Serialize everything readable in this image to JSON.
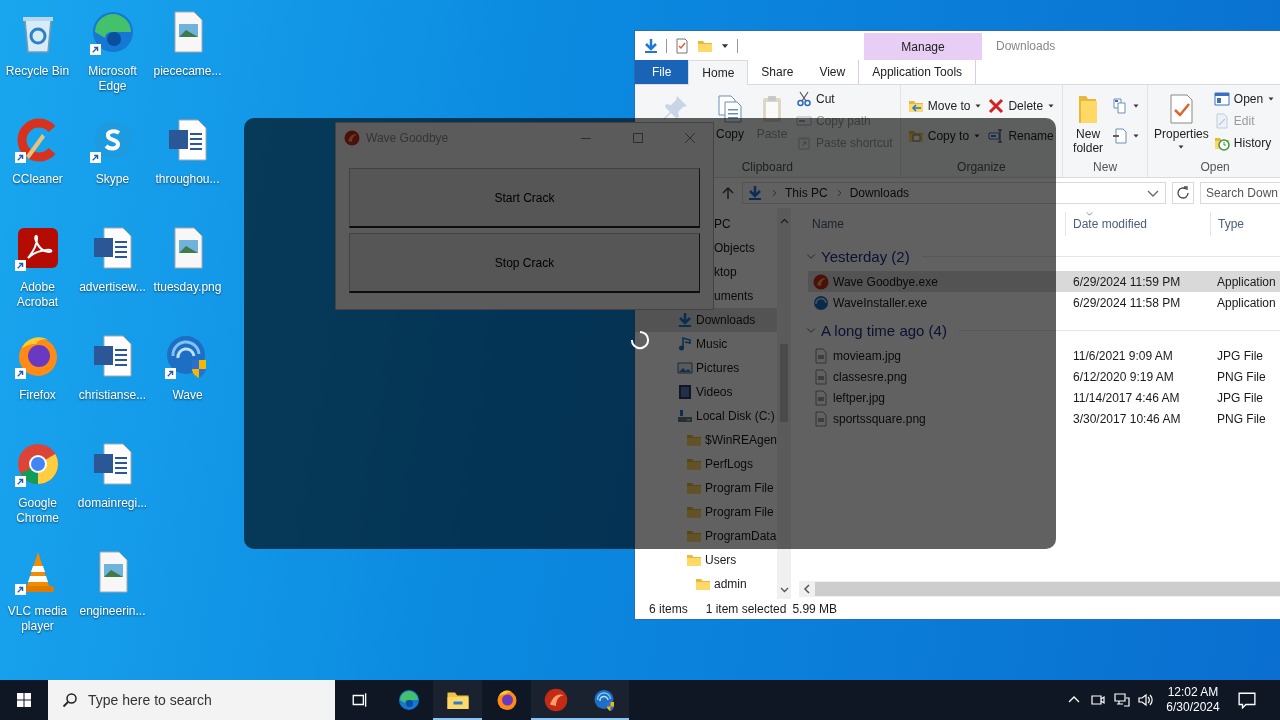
{
  "desktop_icons": [
    {
      "label": "Recycle Bin",
      "kind": "recycle",
      "shortcut": false
    },
    {
      "label": "CCleaner",
      "kind": "ccleaner",
      "shortcut": true
    },
    {
      "label": "Adobe Acrobat",
      "kind": "acrobat",
      "shortcut": true
    },
    {
      "label": "Firefox",
      "kind": "firefox",
      "shortcut": true
    },
    {
      "label": "Google Chrome",
      "kind": "chrome",
      "shortcut": true
    },
    {
      "label": "VLC media player",
      "kind": "vlc",
      "shortcut": true
    },
    {
      "label": "Microsoft Edge",
      "kind": "edge",
      "shortcut": true
    },
    {
      "label": "Skype",
      "kind": "skype",
      "shortcut": true
    },
    {
      "label": "advertisew...",
      "kind": "word",
      "shortcut": false
    },
    {
      "label": "christianse...",
      "kind": "word",
      "shortcut": false
    },
    {
      "label": "domainregi...",
      "kind": "word",
      "shortcut": false
    },
    {
      "label": "engineerin...",
      "kind": "image",
      "shortcut": false
    },
    {
      "label": "piececame...",
      "kind": "image",
      "shortcut": false
    },
    {
      "label": "throughou...",
      "kind": "word",
      "shortcut": false
    },
    {
      "label": "ttuesday.png",
      "kind": "image",
      "shortcut": false
    },
    {
      "label": "Wave",
      "kind": "wave",
      "shortcut": true
    }
  ],
  "explorer": {
    "context_tab": "Manage",
    "title": "Downloads",
    "tabs": [
      {
        "label": "File",
        "kind": "file",
        "selected": false
      },
      {
        "label": "Home",
        "kind": "tab",
        "selected": true
      },
      {
        "label": "Share",
        "kind": "tab",
        "selected": false
      },
      {
        "label": "View",
        "kind": "tab",
        "selected": false
      },
      {
        "label": "Application Tools",
        "kind": "context",
        "selected": false
      }
    ],
    "ribbon": [
      {
        "label": "Clipboard",
        "blocks": [
          {
            "kind": "pin",
            "dropdown": false,
            "disabled": true
          },
          {
            "kind": "copy",
            "label": "Copy",
            "dropdown": false,
            "disabled": false
          },
          {
            "kind": "paste",
            "label": "Paste",
            "dropdown": false,
            "disabled": true
          },
          {
            "items": [
              {
                "kind": "cut",
                "label": "Cut",
                "dropdown": false,
                "disabled": false
              },
              {
                "kind": "copypath",
                "label": "Copy path",
                "dropdown": false,
                "disabled": true
              },
              {
                "kind": "pasteshortcut",
                "label": "Paste shortcut",
                "dropdown": false,
                "disabled": true
              }
            ]
          }
        ]
      },
      {
        "label": "Organize",
        "blocks": [
          {
            "items": [
              {
                "kind": "moveto",
                "label": "Move to",
                "dropdown": true,
                "disabled": false
              },
              {
                "kind": "copyto",
                "label": "Copy to",
                "dropdown": true,
                "disabled": false
              }
            ]
          },
          {
            "items": [
              {
                "kind": "delete",
                "label": "Delete",
                "dropdown": true,
                "disabled": false
              },
              {
                "kind": "rename",
                "label": "Rename",
                "dropdown": false,
                "disabled": false
              }
            ]
          }
        ]
      },
      {
        "label": "New",
        "blocks": [
          {
            "kind": "newfolder",
            "label": "New folder",
            "dropdown": false,
            "disabled": false
          },
          {
            "items": [
              {
                "kind": "newitem",
                "dropdown": true,
                "disabled": false
              },
              {
                "kind": "easyaccess",
                "dropdown": true,
                "disabled": false
              }
            ]
          }
        ]
      },
      {
        "label": "Open",
        "blocks": [
          {
            "kind": "properties",
            "label": "Properties",
            "dropdown": true,
            "disabled": false
          },
          {
            "items": [
              {
                "kind": "open",
                "label": "Open",
                "dropdown": true,
                "disabled": false
              },
              {
                "kind": "edit",
                "label": "Edit",
                "dropdown": false,
                "disabled": true
              },
              {
                "kind": "history",
                "label": "History",
                "dropdown": false,
                "disabled": false
              }
            ]
          }
        ]
      }
    ],
    "address": {
      "path": [
        "This PC",
        "Downloads"
      ],
      "search_placeholder": "Search Down"
    },
    "nav_pane": [
      {
        "label": "PC",
        "partial": true,
        "selected": false,
        "children": [
          {
            "label": "Objects",
            "partial": true,
            "selected": false
          },
          {
            "label": "ktop",
            "partial": true,
            "selected": false
          },
          {
            "label": "uments",
            "partial": true,
            "selected": false
          },
          {
            "label": "Downloads",
            "kind": "downloads",
            "partial": false,
            "selected": true
          },
          {
            "label": "Music",
            "kind": "music",
            "partial": false,
            "selected": false
          },
          {
            "label": "Pictures",
            "kind": "pictures",
            "partial": false,
            "selected": false
          },
          {
            "label": "Videos",
            "kind": "videos",
            "partial": false,
            "selected": false
          },
          {
            "label": "Local Disk (C:)",
            "kind": "disk",
            "partial": false,
            "selected": false,
            "children": [
              {
                "label": "$WinREAgen",
                "kind": "folder",
                "partial": false,
                "selected": false
              },
              {
                "label": "PerfLogs",
                "kind": "folder",
                "partial": false,
                "selected": false
              },
              {
                "label": "Program File",
                "kind": "folder",
                "partial": false,
                "selected": false
              },
              {
                "label": "Program File",
                "kind": "folder",
                "partial": false,
                "selected": false
              },
              {
                "label": "ProgramData",
                "kind": "folder",
                "partial": false,
                "selected": false
              },
              {
                "label": "Users",
                "kind": "folder",
                "partial": false,
                "selected": false,
                "children": [
                  {
                    "label": "admin",
                    "kind": "folder",
                    "partial": false,
                    "selected": false
                  }
                ]
              }
            ]
          }
        ]
      }
    ],
    "columns": [
      "Name",
      "Date modified",
      "Type"
    ],
    "groups": [
      {
        "label": "Yesterday (2)",
        "expanded": true,
        "files": [
          {
            "name": "Wave Goodbye.exe",
            "kind": "wavegoodbye",
            "date": "6/29/2024 11:59 PM",
            "type": "Application",
            "selected": true
          },
          {
            "name": "WaveInstaller.exe",
            "kind": "waveinstaller",
            "date": "6/29/2024 11:58 PM",
            "type": "Application",
            "selected": false
          }
        ]
      },
      {
        "label": "A long time ago (4)",
        "expanded": true,
        "files": [
          {
            "name": "movieam.jpg",
            "kind": "imagefile",
            "date": "11/6/2021 9:09 AM",
            "type": "JPG File",
            "selected": false
          },
          {
            "name": "classesre.png",
            "kind": "imagefile",
            "date": "6/12/2020 9:19 AM",
            "type": "PNG File",
            "selected": false
          },
          {
            "name": "leftper.jpg",
            "kind": "imagefile",
            "date": "11/14/2017 4:46 AM",
            "type": "JPG File",
            "selected": false
          },
          {
            "name": "sportssquare.png",
            "kind": "imagefile",
            "date": "3/30/2017 10:46 AM",
            "type": "PNG File",
            "selected": false
          }
        ]
      }
    ],
    "status": {
      "count": "6 items",
      "selection": "1 item selected",
      "size": "5.99 MB"
    }
  },
  "dialog": {
    "title": "Wave Goodbye",
    "buttons": [
      "Start Crack",
      "Stop Crack"
    ]
  },
  "taskbar": {
    "search_placeholder": "Type here to search",
    "apps": [
      {
        "kind": "taskview",
        "running": false
      },
      {
        "kind": "edge",
        "running": false
      },
      {
        "kind": "explorer",
        "running": true
      },
      {
        "kind": "firefox",
        "running": false
      },
      {
        "kind": "wavegoodbye",
        "running": true
      },
      {
        "kind": "wave",
        "running": true
      }
    ],
    "time": "12:02 AM",
    "date": "6/30/2024"
  }
}
